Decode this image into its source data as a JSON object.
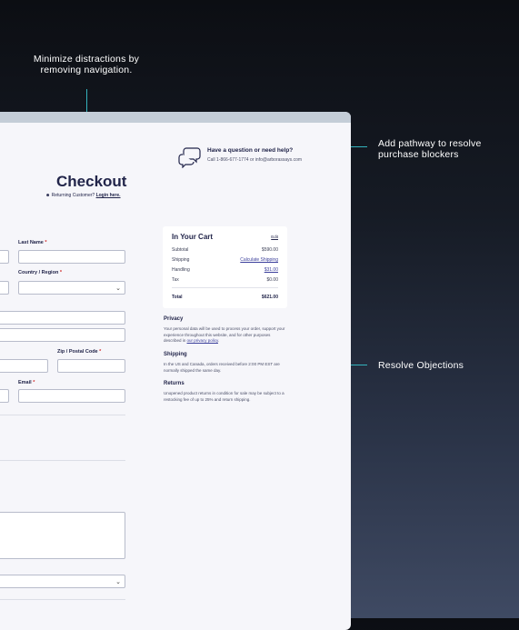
{
  "annotations": {
    "top": "Minimize distractions by removing navigation.",
    "help": "Add pathway to  resolve purchase blockers",
    "objections": "Resolve Objections"
  },
  "page": {
    "help": {
      "icon": "chat-bubbles-icon",
      "title": "Have a question or need help?",
      "contact": "Call 1-866-677-1774 or info@arborassays.com"
    },
    "title": "Checkout",
    "returning_prefix": "Returning Customer?",
    "returning_link": "Login here.",
    "form": {
      "last_name_label": "Last Name",
      "country_label": "Country / Region",
      "zip_label": "Zip / Postal Code",
      "email_label": "Email",
      "required_mark": "*"
    },
    "cart": {
      "title": "In Your Cart",
      "edit": "Edit",
      "rows": [
        {
          "label": "Subtotal",
          "value": "$590.00"
        },
        {
          "label": "Shipping",
          "value": "Calculate Shipping"
        },
        {
          "label": "Handling",
          "value": "$31.00"
        },
        {
          "label": "Tax",
          "value": "$0.00"
        }
      ],
      "total_label": "Total",
      "total_value": "$621.00"
    },
    "privacy": {
      "heading": "Privacy",
      "text": "Your personal data will be used to process your order, support your experience throughout this website, and for other purposes described in",
      "link": "our privacy policy",
      "end": "."
    },
    "shipping": {
      "heading": "Shipping",
      "text": "In the US and Canada, orders received before 2:00 PM EST are normally shipped the same day."
    },
    "returns": {
      "heading": "Returns",
      "text": "Unopened product returns in condition for sale may be subject to a restocking fee of up to 25% and return shipping."
    }
  }
}
